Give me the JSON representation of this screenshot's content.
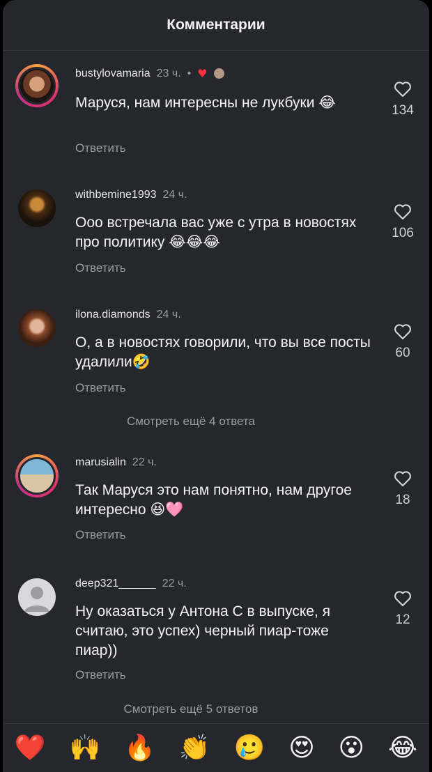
{
  "header": {
    "title": "Комментарии"
  },
  "comments": [
    {
      "username": "bustylovamaria",
      "time": "23 ч.",
      "dot": "•",
      "text": "Маруся, нам интересны не лукбуки 😂",
      "reply": "Ответить",
      "likes": "134",
      "avatar_icon": "profile-photo"
    },
    {
      "username": "withbemine1993",
      "time": "24 ч.",
      "text": "Ооо встречала вас уже с утра в новостях про политику 😂😂😂",
      "reply": "Ответить",
      "likes": "106",
      "avatar_icon": "profile-photo"
    },
    {
      "username": "ilona.diamonds",
      "time": "24 ч.",
      "text": "О, а в новостях говорили, что вы все посты удалили🤣",
      "reply": "Ответить",
      "likes": "60",
      "avatar_icon": "profile-photo"
    },
    {
      "username": "marusialin",
      "time": "22 ч.",
      "text": "Так Маруся это нам понятно, нам другое интересно 😆🩷",
      "reply": "Ответить",
      "likes": "18",
      "avatar_icon": "profile-photo"
    },
    {
      "username": "deep321______",
      "time": "22 ч.",
      "text": "Ну оказаться у Антона С в выпуске, я считаю, это успех) черный пиар-тоже пиар))",
      "reply": "Ответить",
      "likes": "12",
      "avatar_icon": "default-user-icon"
    }
  ],
  "view_more": [
    "Смотреть ещё 4 ответа",
    "Смотреть ещё 5 ответов"
  ],
  "emoji_bar": [
    "❤️",
    "🙌",
    "🔥",
    "👏",
    "🥲",
    "😍",
    "😮",
    "😂"
  ],
  "colors": {
    "background": "#25272c",
    "secondary_text": "#9a9ca2",
    "heart_red": "#ff3040"
  }
}
